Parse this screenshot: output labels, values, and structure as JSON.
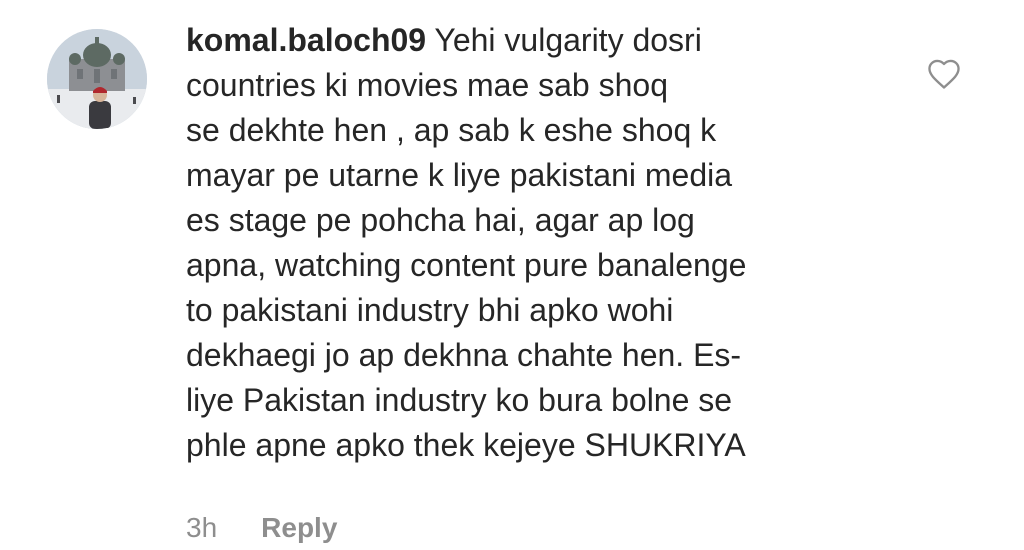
{
  "comment": {
    "username": "komal.baloch09",
    "text": "Yehi vulgarity dosri\ncountries ki movies mae sab shoq\nse dekhte hen , ap sab k eshe shoq k\nmayar pe utarne k liye pakistani media\nes stage pe pohcha hai, agar ap log\napna, watching content pure banalenge\nto pakistani industry bhi apko wohi\ndekhaegi jo ap dekhna chahte hen. Es-\nliye Pakistan industry ko bura bolne se\nphle apne apko thek kejeye  SHUKRIYA",
    "timestamp": "3h",
    "reply_label": "Reply",
    "like_icon": "heart-outline-icon"
  },
  "colors": {
    "text": "#262626",
    "secondary": "#8e8e8e",
    "background": "#ffffff"
  }
}
